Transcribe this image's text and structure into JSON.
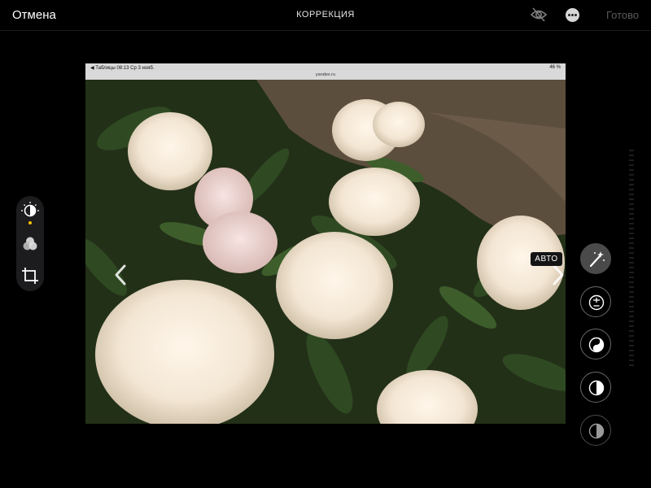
{
  "topbar": {
    "cancel_label": "Отмена",
    "title": "КОРРЕКЦИЯ",
    "done_label": "Готово",
    "icons": [
      "eye-slash-icon",
      "more-icon"
    ]
  },
  "screenshot_status": {
    "left": "◀ Таблицы   08:13   Ср 3 нояб.",
    "right": "46 %",
    "url": "yandex.ru"
  },
  "left_tools": [
    "adjust-icon",
    "filters-icon",
    "crop-icon"
  ],
  "auto_badge": "АВТО",
  "adjustments": [
    "auto-enhance-icon",
    "exposure-icon",
    "brilliance-icon",
    "highlights-icon",
    "shadows-icon"
  ],
  "colors": {
    "background": "#000000",
    "accent": "#f5c400",
    "done_disabled": "#5a5a5a"
  }
}
